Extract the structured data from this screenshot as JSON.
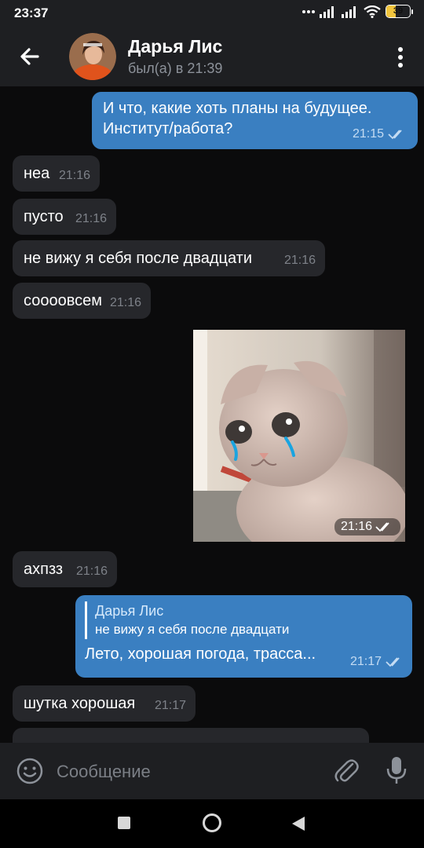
{
  "status_bar": {
    "time": "23:37",
    "battery": "39"
  },
  "header": {
    "contact_name": "Дарья Лис",
    "last_seen": "был(а) в 21:39"
  },
  "messages": [
    {
      "dir": "out",
      "text": "И что, какие хоть планы на будущее. Институт/работа?",
      "time": "21:15"
    },
    {
      "dir": "in",
      "text": "неа",
      "time": "21:16"
    },
    {
      "dir": "in",
      "text": "пусто",
      "time": "21:16"
    },
    {
      "dir": "in",
      "text": "не вижу я себя после двадцати",
      "time": "21:16"
    },
    {
      "dir": "in",
      "text": "соооовсем",
      "time": "21:16"
    },
    {
      "dir": "out",
      "type": "photo",
      "time": "21:16"
    },
    {
      "dir": "in",
      "text": "ахпзз",
      "time": "21:16"
    },
    {
      "dir": "out",
      "reply_to_name": "Дарья Лис",
      "reply_to_text": "не вижу я себя после двадцати",
      "text": "Лето, хорошая погода, трасса...",
      "time": "21:17"
    },
    {
      "dir": "in",
      "text": "шутка хорошая",
      "time": "21:17"
    }
  ],
  "input": {
    "placeholder": "Сообщение"
  },
  "colors": {
    "outgoing": "#3a7fc1",
    "incoming": "#26272b",
    "background": "#0b0b0c",
    "header": "#1e1f22"
  }
}
